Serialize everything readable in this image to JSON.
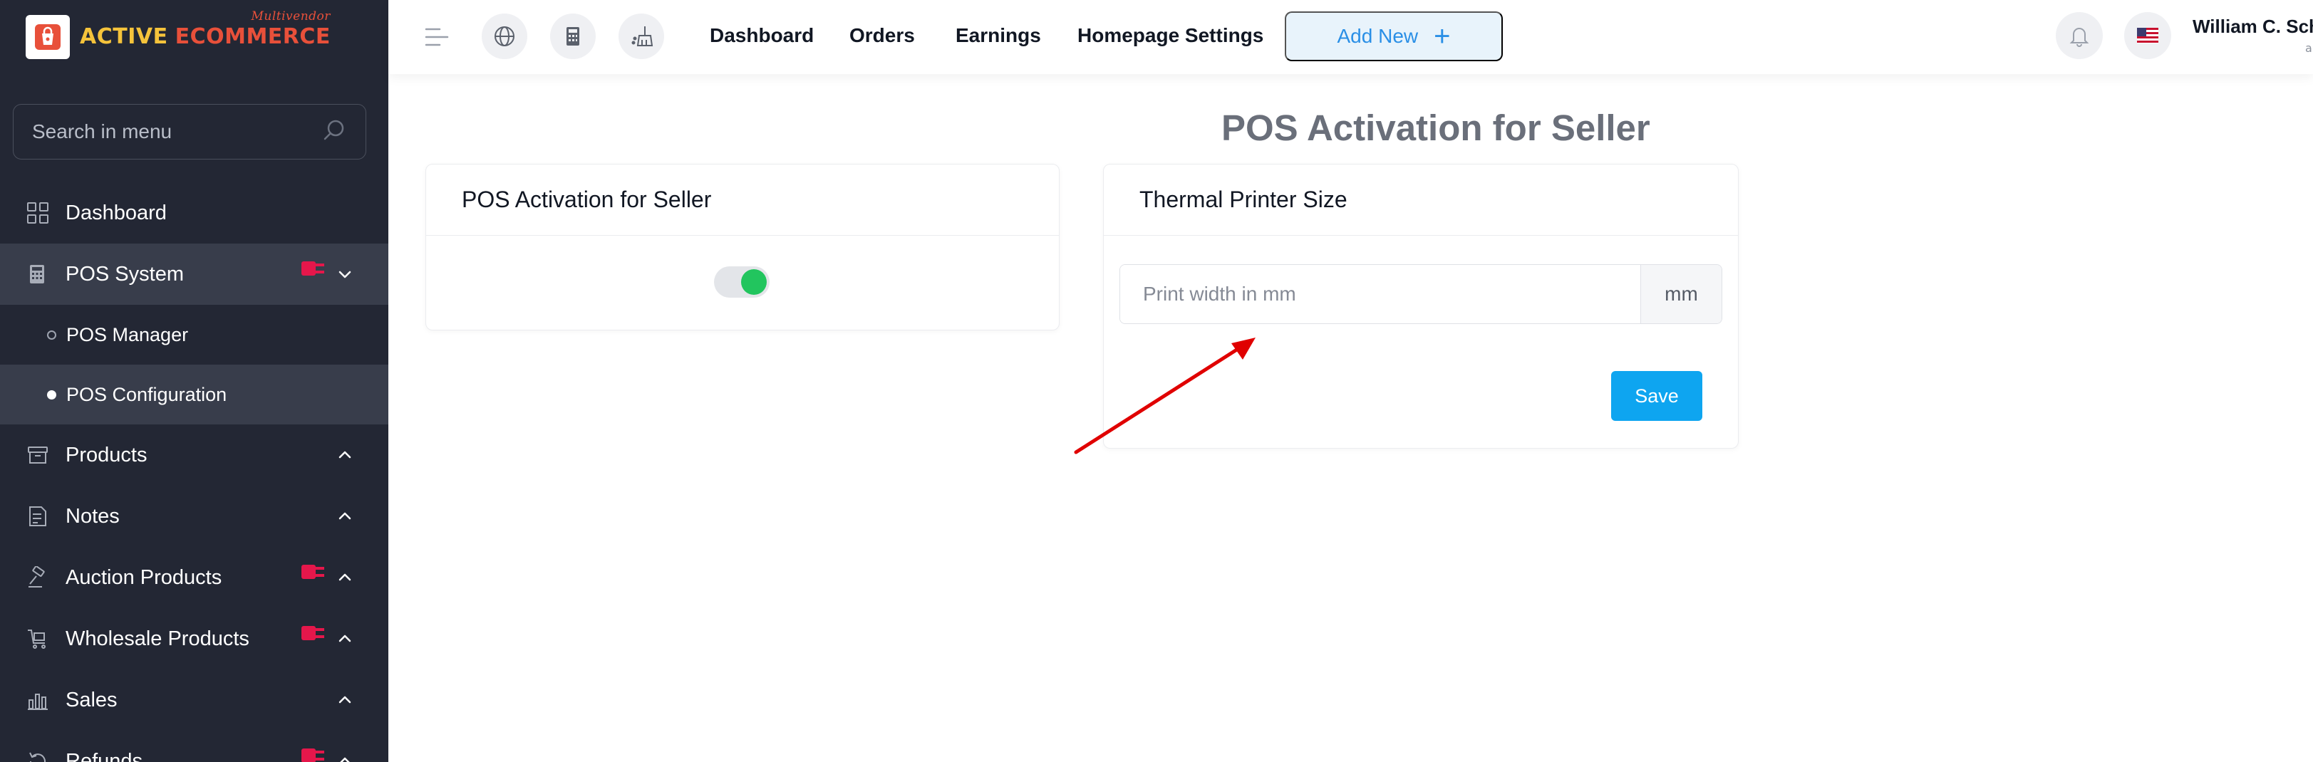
{
  "colors": {
    "sidebar_bg": "#232734",
    "sidebar_active": "#383d4b",
    "accent_blue": "#0ea5f0",
    "toggle_on": "#22c55e",
    "addon_red": "#e5174b",
    "annotation_arrow": "#e00000"
  },
  "logo": {
    "word1": "ACTIVE",
    "word2": "ECOMMERCE",
    "tagline": "Multivendor",
    "icon": "shopping-bag-icon"
  },
  "sidebar": {
    "search_placeholder": "Search in menu",
    "items": [
      {
        "label": "Dashboard",
        "icon": "dashboard-grid-icon"
      },
      {
        "label": "POS System",
        "icon": "calculator-icon",
        "addon": true,
        "expanded": true,
        "children": [
          {
            "label": "POS Manager"
          },
          {
            "label": "POS Configuration",
            "active": true
          }
        ]
      },
      {
        "label": "Products",
        "icon": "box-icon"
      },
      {
        "label": "Notes",
        "icon": "note-icon"
      },
      {
        "label": "Auction Products",
        "icon": "gavel-icon",
        "addon": true
      },
      {
        "label": "Wholesale Products",
        "icon": "cart-icon",
        "addon": true
      },
      {
        "label": "Sales",
        "icon": "bar-chart-icon"
      },
      {
        "label": "Refunds",
        "icon": "refund-icon",
        "addon": true
      }
    ]
  },
  "header": {
    "nav": [
      "Dashboard",
      "Orders",
      "Earnings",
      "Homepage Settings"
    ],
    "add_new": "Add New",
    "user_name": "William C. Schr",
    "user_role": "a"
  },
  "main": {
    "page_title": "POS Activation for Seller",
    "card1": {
      "title": "POS Activation for Seller",
      "toggle_on": true
    },
    "card2": {
      "title": "Thermal Printer Size",
      "input_placeholder": "Print width in mm",
      "input_value": "",
      "unit": "mm",
      "save_label": "Save"
    }
  }
}
